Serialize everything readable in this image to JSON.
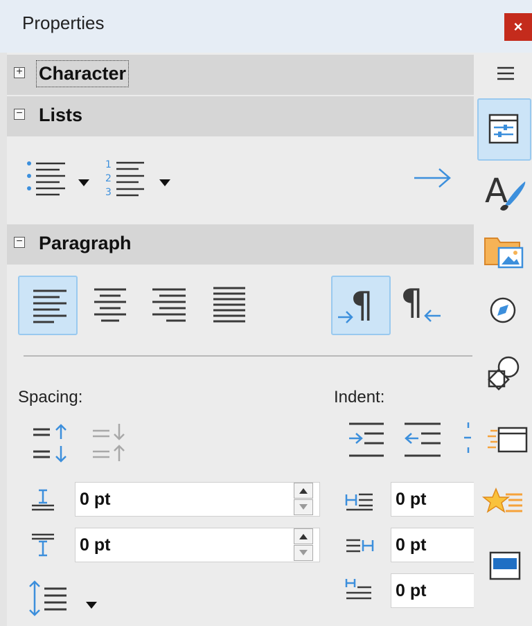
{
  "panel": {
    "title": "Properties",
    "close_label": "×"
  },
  "sections": {
    "character": {
      "title": "Character",
      "state": "collapsed"
    },
    "lists": {
      "title": "Lists",
      "state": "expanded"
    },
    "paragraph": {
      "title": "Paragraph",
      "state": "expanded"
    }
  },
  "paragraph": {
    "alignment_selected": "left",
    "direction_selected": "left-to-right",
    "spacing_label": "Spacing:",
    "indent_label": "Indent:",
    "above_spacing": "0 pt",
    "below_spacing": "0 pt",
    "before_indent": "0 pt",
    "after_indent": "0 pt",
    "first_line_indent": "0 pt"
  },
  "sidebar": {
    "menu_icon": "hamburger-icon",
    "tabs": [
      "properties",
      "styles",
      "gallery",
      "navigator",
      "shapes",
      "page",
      "manage-changes",
      "design"
    ],
    "selected": "properties"
  },
  "colors": {
    "accent": "#3c8fdc",
    "close_bg": "#c42b1c",
    "active_btn": "#cce4f7"
  }
}
